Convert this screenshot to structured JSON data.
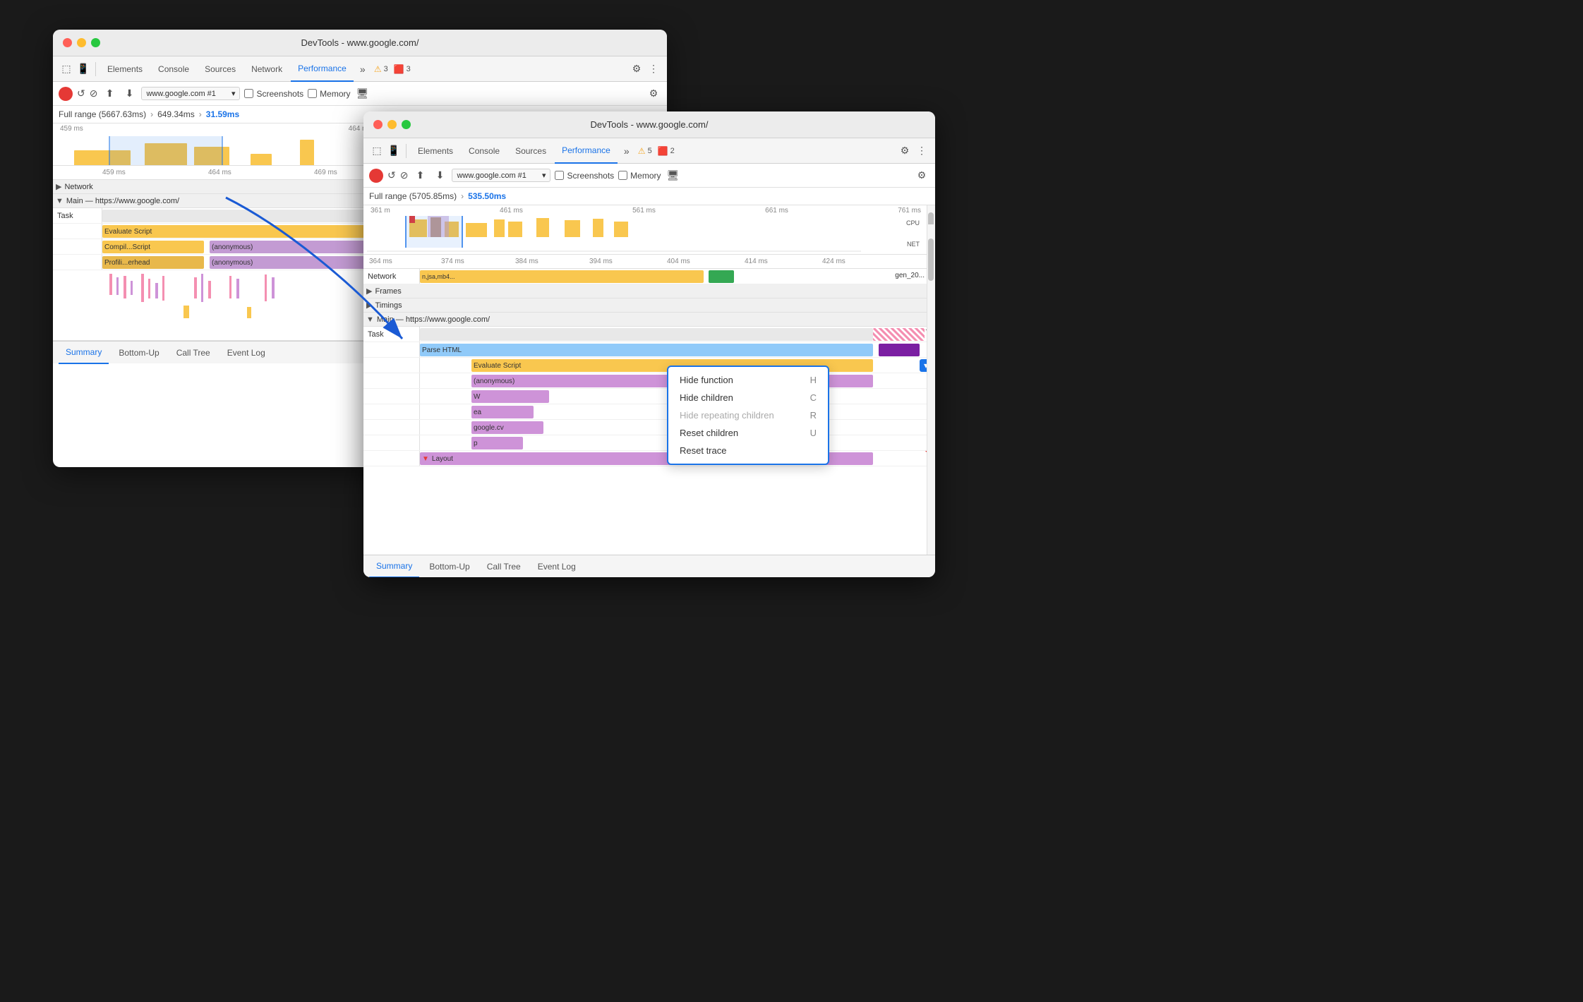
{
  "bg_window": {
    "title": "DevTools - www.google.com/",
    "tabs": [
      "Elements",
      "Console",
      "Sources",
      "Network",
      "Performance"
    ],
    "active_tab": "Performance",
    "warnings": "3",
    "errors": "3",
    "url": "www.google.com #1",
    "breadcrumb": {
      "range": "Full range (5667.63ms)",
      "sub": "649.34ms",
      "active": "31.59ms"
    },
    "ruler_ticks": [
      "459 ms",
      "464 ms",
      "469 ms"
    ],
    "ruler_ticks2": [
      "459 ms",
      "464 ms",
      "469 ms"
    ],
    "sections": {
      "network": "Network",
      "main": "Main — https://www.google.com/",
      "task": "Task",
      "evaluate_script": "Evaluate Script",
      "compil_script": "Compil...Script",
      "profili_erhead": "Profili...erhead",
      "anonymous": "(anonymous)"
    },
    "bottom_tabs": [
      "Summary",
      "Bottom-Up",
      "Call Tree",
      "Event Log"
    ]
  },
  "fg_window": {
    "title": "DevTools - www.google.com/",
    "tabs": [
      "Elements",
      "Console",
      "Sources",
      "Performance"
    ],
    "active_tab": "Performance",
    "warnings": "5",
    "errors": "2",
    "url": "www.google.com #1",
    "breadcrumb": {
      "range": "Full range (5705.85ms)",
      "sub": "535.50ms"
    },
    "ruler_ticks_top": [
      "361 m",
      "461 ms",
      "561 ms",
      "661 ms",
      "761 ms"
    ],
    "ruler_ticks_bottom": [
      "364 ms",
      "374 ms",
      "384 ms",
      "394 ms",
      "404 ms",
      "414 ms",
      "424 ms"
    ],
    "sections": {
      "network": "Network",
      "network_detail": "n,jsa,mb4...",
      "frames": "Frames",
      "timings": "Timings",
      "main": "Main — https://www.google.com/",
      "task": "Task",
      "parse_html": "Parse HTML",
      "evaluate_script": "Evaluate Script",
      "anonymous": "(anonymous)",
      "w": "W",
      "ea": "ea",
      "google_cv": "google.cv",
      "p": "p",
      "layout": "Layout",
      "gen20": "gen_20..."
    },
    "cpu_label": "CPU",
    "net_label": "NET",
    "bottom_tabs": [
      "Summary",
      "Bottom-Up",
      "Call Tree",
      "Event Log"
    ]
  },
  "context_menu": {
    "items": [
      {
        "label": "Hide function",
        "shortcut": "H",
        "disabled": false
      },
      {
        "label": "Hide children",
        "shortcut": "C",
        "disabled": false
      },
      {
        "label": "Hide repeating children",
        "shortcut": "R",
        "disabled": true
      },
      {
        "label": "Reset children",
        "shortcut": "U",
        "disabled": false
      },
      {
        "label": "Reset trace",
        "shortcut": "",
        "disabled": false
      }
    ]
  },
  "colors": {
    "yellow": "#f9c74f",
    "gold": "#e8b84b",
    "purple": "#c39bd3",
    "blue": "#1a73e8",
    "green": "#34a853",
    "red": "#e53935",
    "gray": "#9e9e9e",
    "pink": "#f48fb1",
    "orange": "#ff7043",
    "light_purple": "#ce93d8",
    "light_blue": "#90caf9",
    "dark_purple": "#7b1fa2",
    "olive": "#8bc34a"
  },
  "icons": {
    "record": "⏺",
    "reload": "↺",
    "clear": "⊘",
    "upload": "⬆",
    "download": "⬇",
    "chevron_down": "▾",
    "chevron_right": "▶",
    "chevron_left": "◀",
    "more": "⋮",
    "gear": "⚙",
    "expand": "▼",
    "collapse": "▶",
    "warning": "⚠",
    "error": "🔴"
  }
}
